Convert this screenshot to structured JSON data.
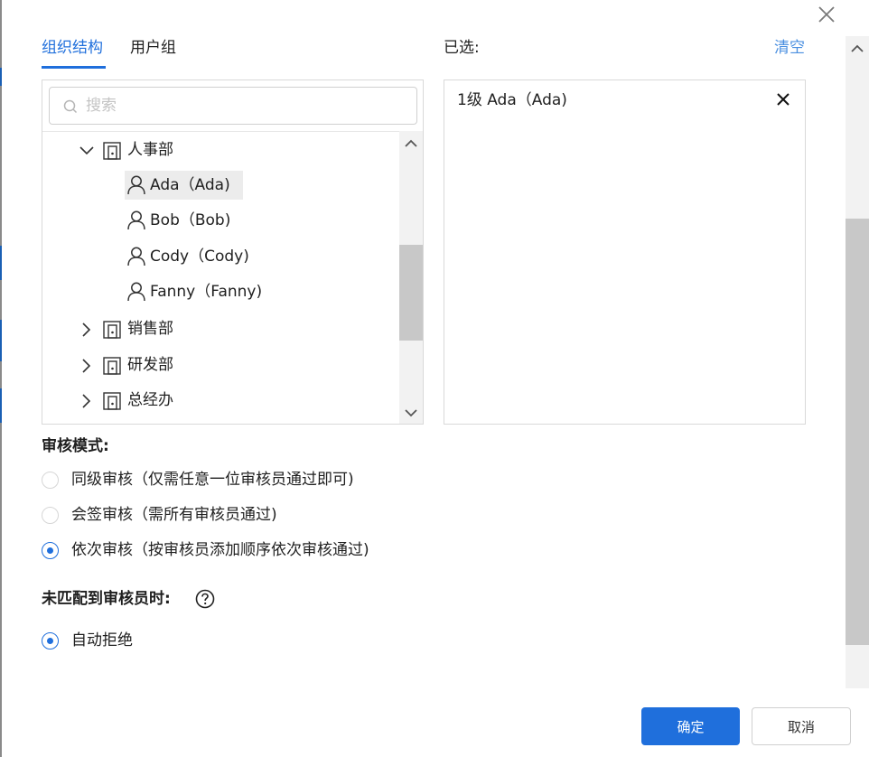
{
  "tabs": [
    {
      "label": "组织结构",
      "active": true
    },
    {
      "label": "用户组",
      "active": false
    }
  ],
  "search": {
    "placeholder": "搜索",
    "value": ""
  },
  "tree": {
    "departments": [
      {
        "name": "人事部",
        "expanded": true,
        "icon": "building-icon"
      },
      {
        "name": "销售部",
        "expanded": false,
        "icon": "building-icon"
      },
      {
        "name": "研发部",
        "expanded": false,
        "icon": "building-icon"
      },
      {
        "name": "总经办",
        "expanded": false,
        "icon": "building-icon"
      }
    ],
    "users": [
      {
        "label": "Ada（Ada)",
        "selected": true,
        "icon": "user-icon"
      },
      {
        "label": "Bob（Bob)",
        "selected": false,
        "icon": "user-icon"
      },
      {
        "label": "Cody（Cody)",
        "selected": false,
        "icon": "user-icon"
      },
      {
        "label": "Fanny（Fanny)",
        "selected": false,
        "icon": "user-icon"
      }
    ]
  },
  "selected": {
    "title": "已选:",
    "clear_label": "清空",
    "items": [
      {
        "label": "1级 Ada（Ada)"
      }
    ]
  },
  "review_mode": {
    "title": "审核模式:",
    "options": [
      {
        "label": "同级审核（仅需任意一位审核员通过即可)",
        "checked": false
      },
      {
        "label": "会签审核（需所有审核员通过)",
        "checked": false
      },
      {
        "label": "依次审核（按审核员添加顺序依次审核通过)",
        "checked": true
      }
    ]
  },
  "no_match": {
    "title": "未匹配到审核员时:",
    "options": [
      {
        "label": "自动拒绝",
        "checked": true
      }
    ]
  },
  "footer": {
    "confirm_label": "确定",
    "cancel_label": "取消"
  },
  "colors": {
    "accent": "#1f6fdc",
    "link": "#4a8fe0",
    "border": "#d9d9d9",
    "selected_row": "#ececec"
  }
}
